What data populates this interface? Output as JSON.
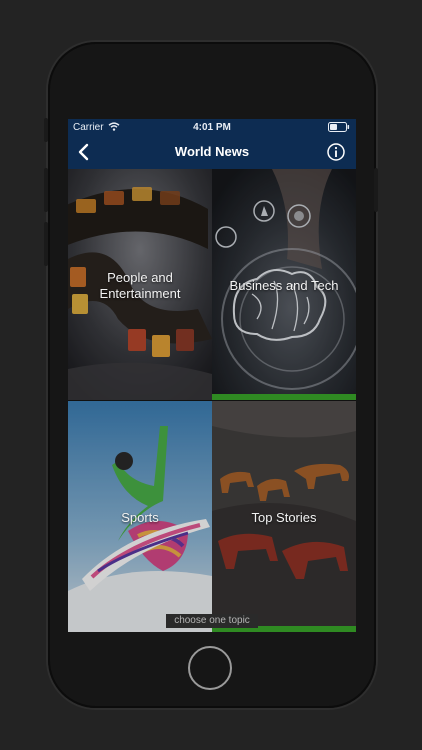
{
  "status_bar": {
    "carrier": "Carrier",
    "time": "4:01 PM"
  },
  "nav": {
    "title": "World News",
    "back_icon": "chevron-left-icon",
    "info_icon": "info-icon"
  },
  "topics": [
    {
      "label": "People and Entertainment"
    },
    {
      "label": "Business and Tech"
    },
    {
      "label": "Sports"
    },
    {
      "label": "Top Stories"
    }
  ],
  "hint": "choose one topic",
  "colors": {
    "nav_bar": "#0d2c52",
    "accent_green": "#2f8a22",
    "background": "#232323"
  }
}
